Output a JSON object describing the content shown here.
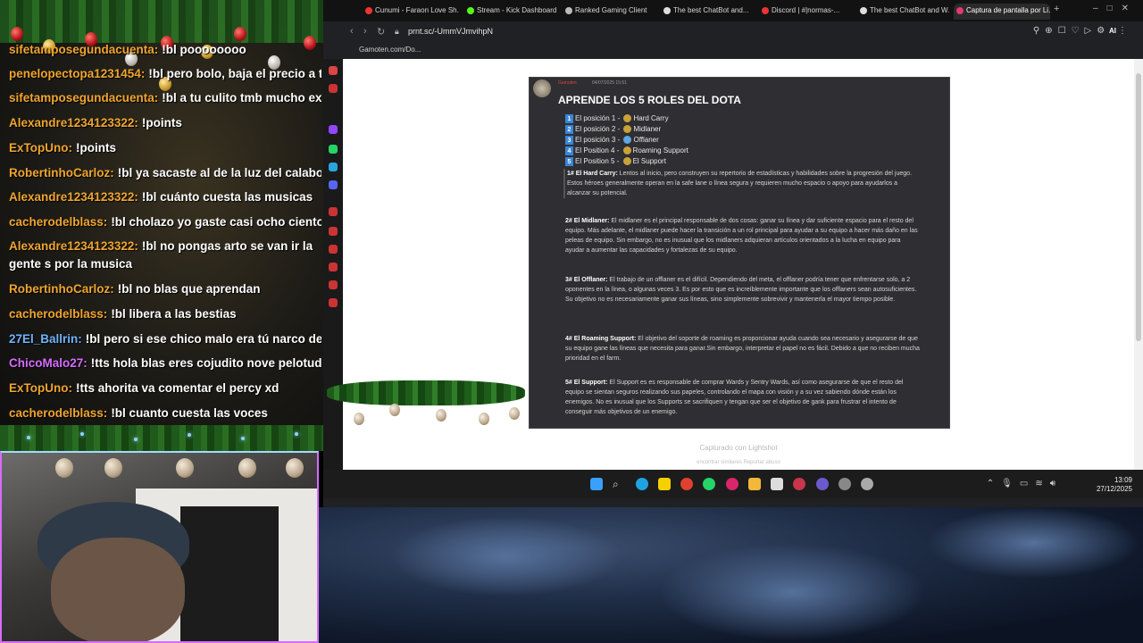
{
  "chat": {
    "messages": [
      {
        "user": "sifetamposegundacuenta:",
        "text": "!bl poooooooo",
        "user_color": "#f0a530"
      },
      {
        "user": "penelopectopa1231454:",
        "text": "!bl pero bolo, baja el precio a todo",
        "user_color": "#f0a530"
      },
      {
        "user": "sifetamposegundacuenta:",
        "text": "!bl a tu culito tmb mucho exijes",
        "user_color": "#f0a530"
      },
      {
        "user": "Alexandre1234123322:",
        "text": "!points",
        "user_color": "#f0a530"
      },
      {
        "user": "ExTopUno:",
        "text": "!points",
        "user_color": "#f0a530"
      },
      {
        "user": "RobertinhoCarloz:",
        "text": "!bl ya sacaste al de la luz del calabozo?",
        "user_color": "#f0a530"
      },
      {
        "user": "Alexandre1234123322:",
        "text": "!bl cuánto cuesta las musicas",
        "user_color": "#f0a530"
      },
      {
        "user": "cacherodelblass:",
        "text": "!bl cholazo yo gaste casi ocho cientos",
        "user_color": "#f0a530"
      },
      {
        "user": "Alexandre1234123322:",
        "text": "!bl no pongas arto se van ir la gente s por la musica",
        "user_color": "#f0a530"
      },
      {
        "user": "RobertinhoCarloz:",
        "text": "!bl no blas que aprendan",
        "user_color": "#f0a530"
      },
      {
        "user": "cacherodelblass:",
        "text": "!bl libera a las bestias",
        "user_color": "#f0a530"
      },
      {
        "user": "27El_Ballrin:",
        "text": "!bl pero si ese chico malo era tú narco de narco",
        "user_color": "#6fb3ff"
      },
      {
        "user": "ChicoMalo27:",
        "text": "!tts hola blas eres cojudito nove pelotudo",
        "user_color": "#d66cff"
      },
      {
        "user": "ExTopUno:",
        "text": "!tts ahorita va comentar el percy xd",
        "user_color": "#f0a530"
      },
      {
        "user": "cacherodelblass:",
        "text": "!bl cuanto cuesta las voces",
        "user_color": "#f0a530"
      }
    ]
  },
  "browser": {
    "tabs": [
      {
        "label": "Cunumi - Faraon Love Sh...",
        "color": "#e33"
      },
      {
        "label": "Stream - Kick Dashboard",
        "color": "#53fc18"
      },
      {
        "label": "Ranked Gaming Client",
        "color": "#bbb"
      },
      {
        "label": "The best ChatBot and...",
        "color": "#ddd"
      },
      {
        "label": "Discord | #|normas-...",
        "color": "#e33"
      },
      {
        "label": "The best ChatBot and W...",
        "color": "#ddd"
      },
      {
        "label": "Captura de pantalla por Li...",
        "color": "#e0387a"
      }
    ],
    "new_tab": "+",
    "url": "prnt.sc/-UmmVJmvihpN",
    "bookmark": "Gamoten.com/Do...",
    "ai_label": "AI"
  },
  "screenshot": {
    "username": "Gamoten",
    "date": "04/07/2025 15:51",
    "title": "APRENDE LOS 5 ROLES DEL DOTA",
    "roles": [
      {
        "num": "1",
        "text": "El posición 1 - ",
        "role": "Hard Carry"
      },
      {
        "num": "2",
        "text": "El posición 2 - ",
        "role": "Midlaner"
      },
      {
        "num": "3",
        "text": "El posición 3 - ",
        "role": "Offlaner"
      },
      {
        "num": "4",
        "text": "El Position 4 - ",
        "role": "Roaming Support"
      },
      {
        "num": "5",
        "text": "El Position 5 - ",
        "role": "El Support"
      }
    ],
    "sections": [
      {
        "head": "1# El Hard Carry:",
        "body": " Lentos al inicio, pero construyen su repertorio de estadísticas y habilidades sobre la progresión del juego. Estos héroes generalmente operan en la safe lane o línea segura y requieren mucho espacio o apoyo para ayudarlos a alcanzar su potencial."
      },
      {
        "head": "2# El Midlaner:",
        "body": " El midlaner es el principal responsable de dos cosas: ganar su línea y dar suficiente espacio para el resto del equipo. Más adelante, el midlaner puede hacer la transición a un rol principal para ayudar a su equipo a hacer más daño en las peleas de equipo. Sin embargo, no es inusual que los midlaners adquieran artículos orientados a la lucha en equipo para ayudar a aumentar las capacidades y fortalezas de su equipo."
      },
      {
        "head": "3# El Offlaner:",
        "body": " El trabajo de un offlaner es el difícil. Dependiendo del meta, el offlaner podría tener que enfrentarse solo, a 2 oponentes en la línea, o algunas veces 3. Es por esto que es increíblemente importante que los offlaners sean autosuficientes. Su objetivo no es necesariamente ganar sus líneas, sino simplemente sobrevivir y mantenerla el mayor tiempo posible."
      },
      {
        "head": "4# El Roaming Support:",
        "body": " El objetivo del soporte de roaming es proporcionar ayuda cuando sea necesario y asegurarse de que su equipo gane las líneas que necesita para ganar.Sin embargo, interpretar el papel no es fácil. Debido a que no reciben mucha prioridad en el farm."
      },
      {
        "head": "5# El Support:",
        "body": " El Support es es responsable de comprar  Wards y Sentry Wards, así como asegurarse de que el resto del equipo se sientan seguros realizando sus papeles, controlando el mapa con visión y a su vez sabiendo dónde están los enemigos. No es inusual que los Supports se sacrifiquen y tengan que ser el objetivo de gank para frustrar el intento de conseguir más objetivos de un enemigo."
      }
    ],
    "captured": "Capturado con Lightshot",
    "links": "encontrar similares    Reportar abuso"
  },
  "taskbar": {
    "time": "13:09",
    "date": "27/12/2025"
  }
}
